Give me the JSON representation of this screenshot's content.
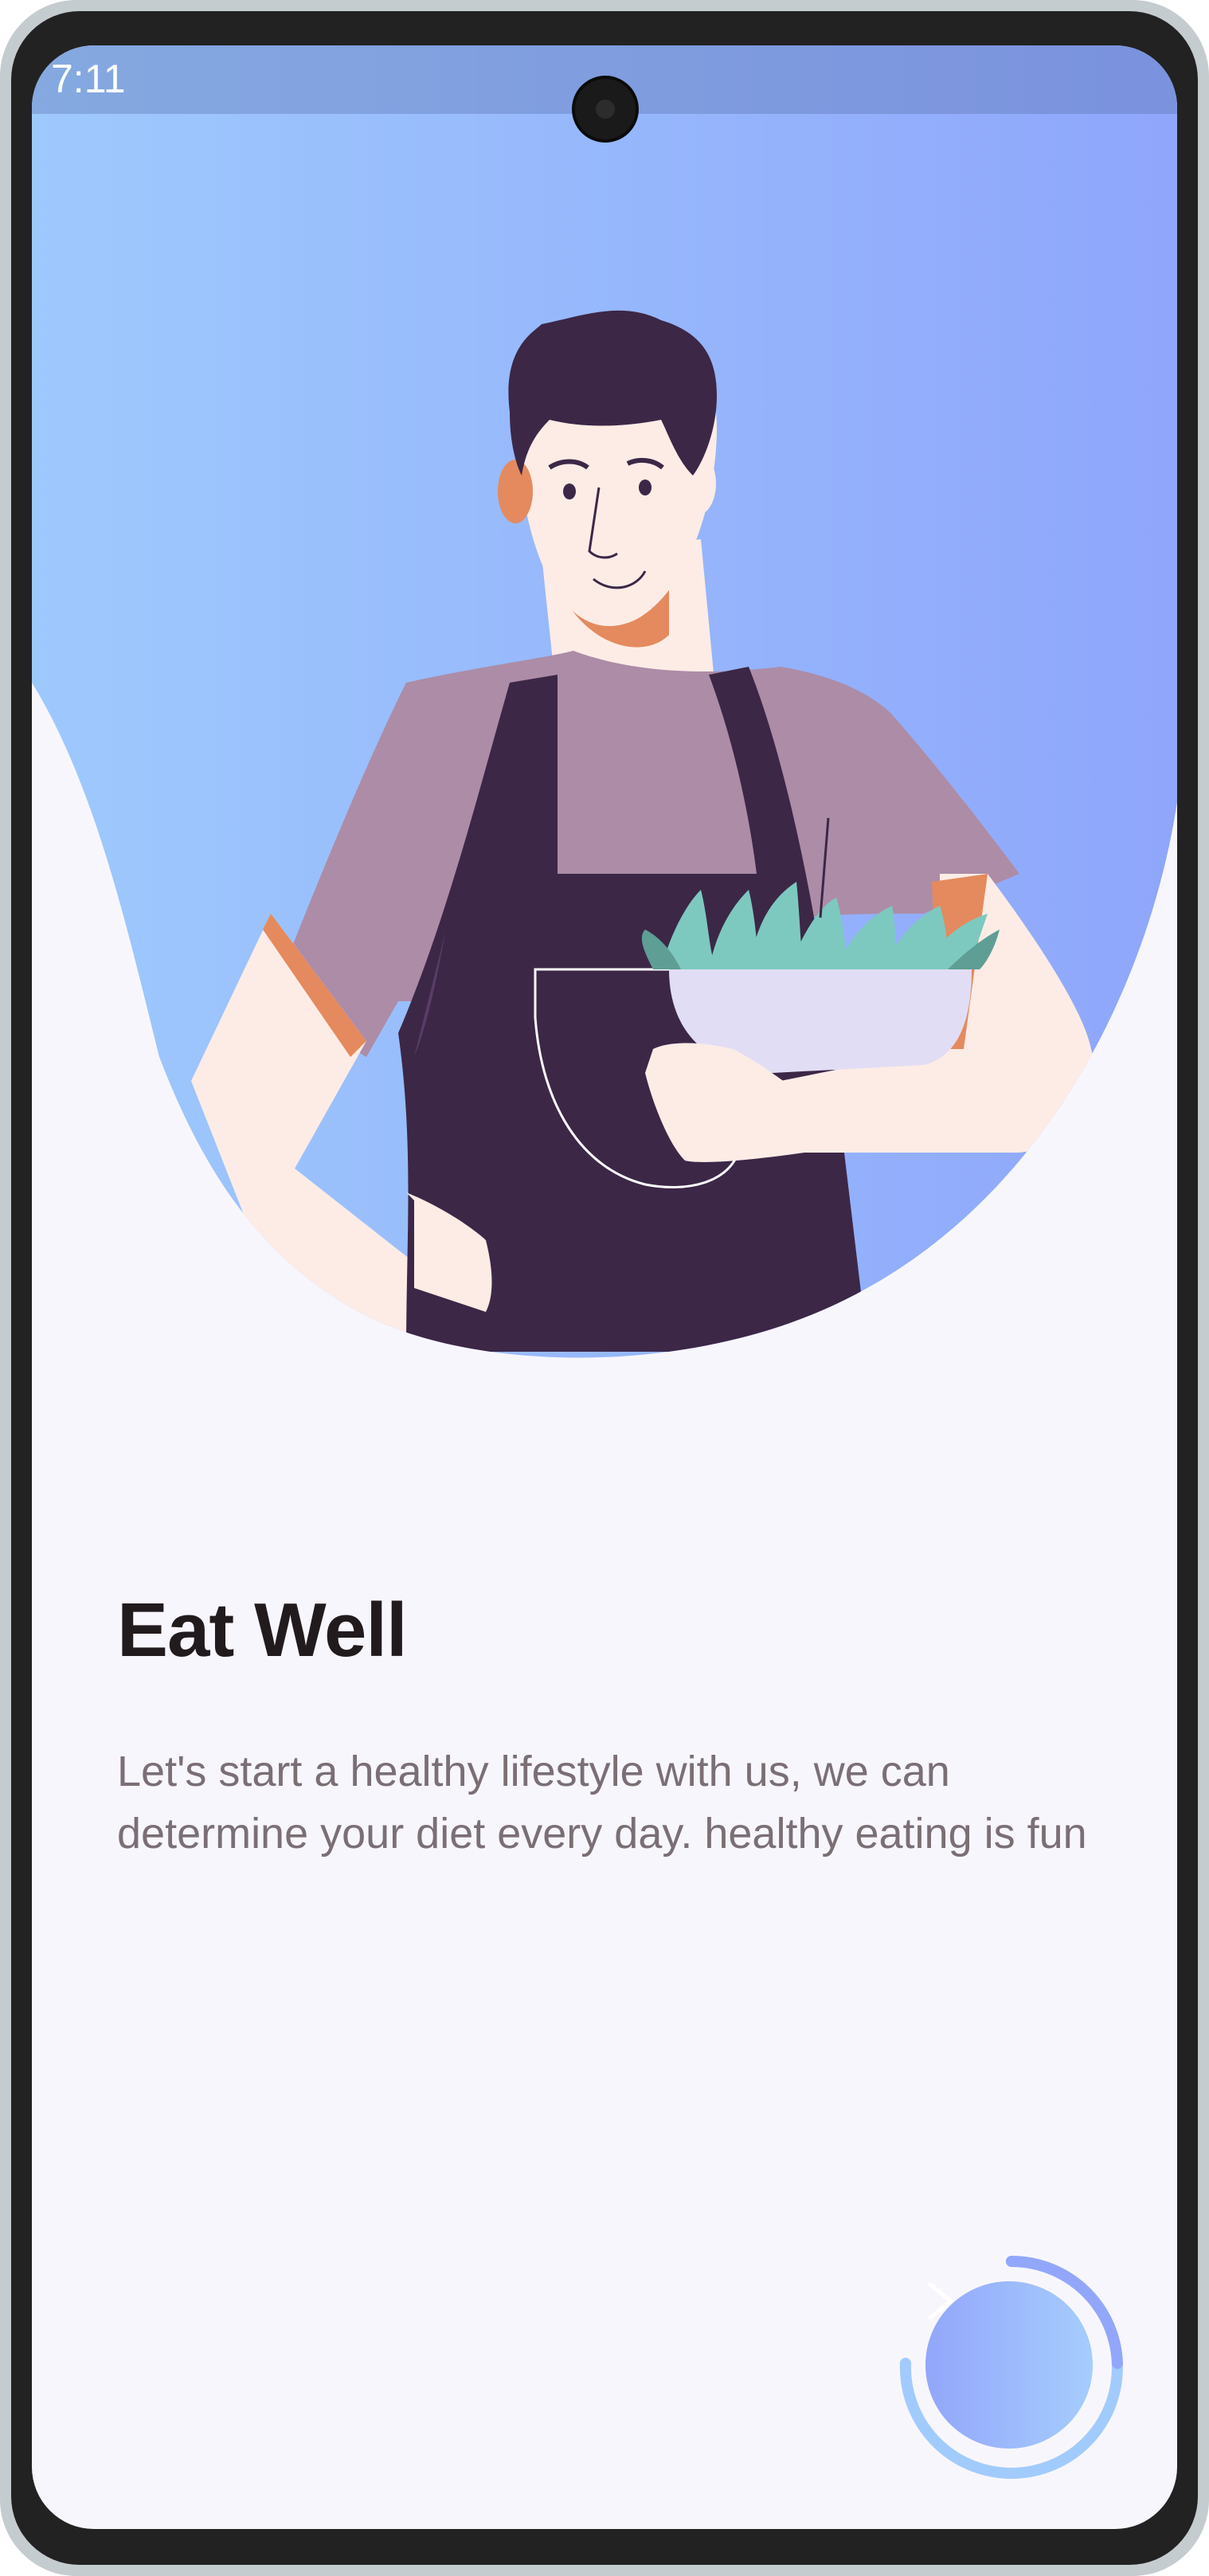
{
  "status_bar": {
    "time": "7:11"
  },
  "onboarding": {
    "title": "Eat Well",
    "description": "Let's start a healthy lifestyle with us, we can determine your diet every day. healthy eating is fun"
  },
  "next_button": {
    "icon": "chevron-right-icon"
  },
  "colors": {
    "background": "#f8f6fd",
    "gradient_start": "#9ec9fd",
    "gradient_end": "#8fa6fb",
    "title": "#221b1e",
    "body_text": "#7a6f75",
    "apron": "#3c2747",
    "shirt": "#ad8ca7",
    "skin": "#fdece6",
    "bowl": "#e1ddf5",
    "greens": "#7dc9c0"
  }
}
